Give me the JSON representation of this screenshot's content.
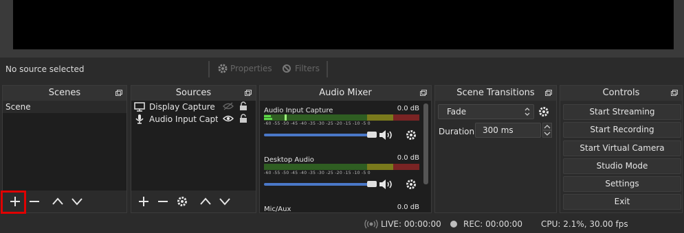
{
  "source_toolbar": {
    "no_source_label": "No source selected",
    "properties_label": "Properties",
    "filters_label": "Filters"
  },
  "docks": {
    "scenes": {
      "title": "Scenes",
      "items": [
        "Scene"
      ]
    },
    "sources": {
      "title": "Sources",
      "items": [
        {
          "label": "Display Capture",
          "icon": "monitor-icon",
          "visible": false
        },
        {
          "label": "Audio Input Captu",
          "icon": "microphone-icon",
          "visible": true
        }
      ]
    },
    "audio_mixer": {
      "title": "Audio Mixer",
      "channels": [
        {
          "name": "Audio Input Capture",
          "db": "0.0 dB",
          "volume_fraction": 1.0
        },
        {
          "name": "Desktop Audio",
          "db": "0.0 dB",
          "volume_fraction": 1.0
        },
        {
          "name": "Mic/Aux",
          "db": "0.0 dB"
        }
      ],
      "scale": "-60 -55 -50 -45 -40 -35 -30 -25 -20 -15 -10 -5 0"
    },
    "scene_transitions": {
      "title": "Scene Transitions",
      "transition": "Fade",
      "duration_label": "Duration",
      "duration_value": "300 ms"
    },
    "controls": {
      "title": "Controls",
      "buttons": [
        "Start Streaming",
        "Start Recording",
        "Start Virtual Camera",
        "Studio Mode",
        "Settings",
        "Exit"
      ]
    }
  },
  "status": {
    "live": "LIVE: 00:00:00",
    "rec": "REC: 00:00:00",
    "cpu": "CPU: 2.1%, 30.00 fps"
  },
  "colors": {
    "highlight": "#e00000",
    "volume_slider": "#4a78c8",
    "meter_green": "#3a7a2a",
    "meter_yellow": "#8a8a1e",
    "meter_red": "#8a2a2a"
  }
}
